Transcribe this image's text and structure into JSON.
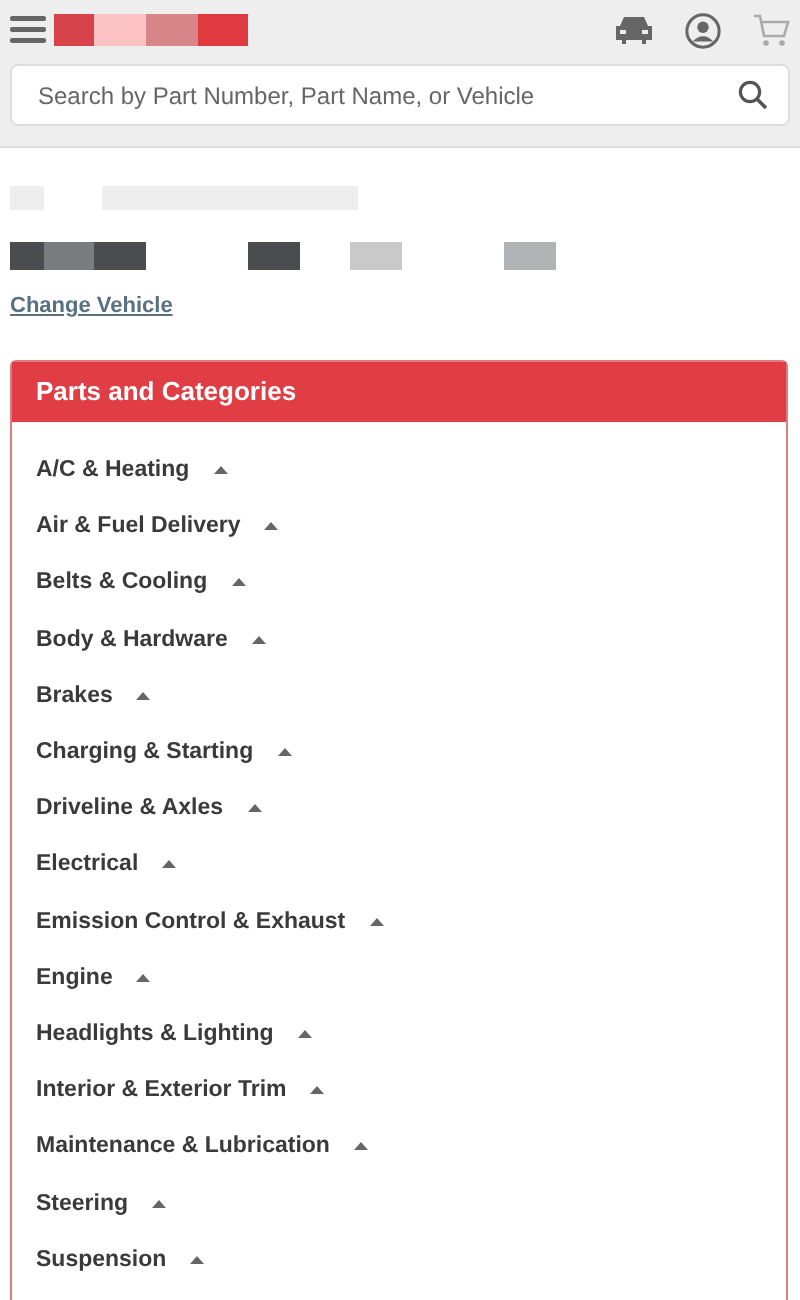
{
  "search": {
    "placeholder": "Search by Part Number, Part Name, or Vehicle"
  },
  "change_vehicle_link": "Change Vehicle",
  "panel": {
    "title": "Parts and Categories",
    "categories": [
      {
        "label": "A/C & Heating"
      },
      {
        "label": "Air & Fuel Delivery"
      },
      {
        "label": "Belts & Cooling"
      },
      {
        "label": "Body & Hardware"
      },
      {
        "label": "Brakes"
      },
      {
        "label": "Charging & Starting"
      },
      {
        "label": "Driveline & Axles"
      },
      {
        "label": "Electrical"
      },
      {
        "label": "Emission Control & Exhaust"
      },
      {
        "label": "Engine"
      },
      {
        "label": "Headlights & Lighting"
      },
      {
        "label": "Interior & Exterior Trim"
      },
      {
        "label": "Maintenance & Lubrication"
      },
      {
        "label": "Steering"
      },
      {
        "label": "Suspension"
      }
    ]
  }
}
